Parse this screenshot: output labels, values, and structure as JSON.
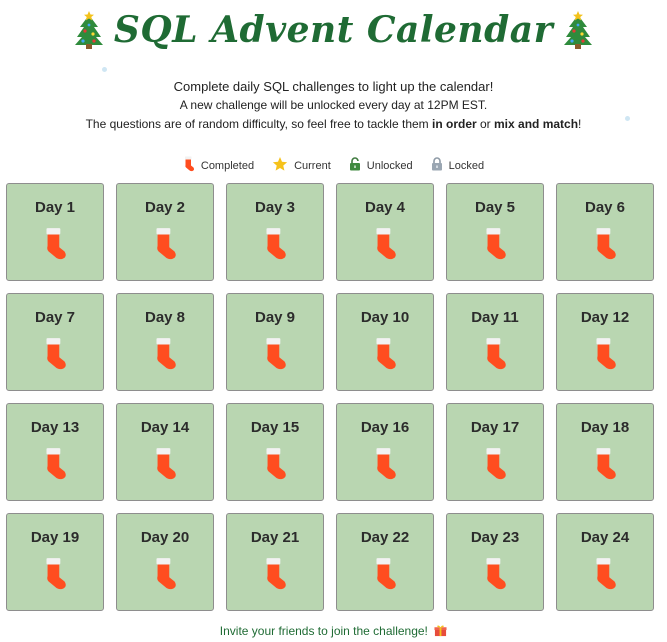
{
  "header": {
    "title": "SQL Advent Calendar",
    "left_icon": "christmas-tree-icon",
    "right_icon": "christmas-tree-icon"
  },
  "intro": {
    "line1": "Complete daily SQL challenges to light up the calendar!",
    "line2": "A new challenge will be unlocked every day at 12PM EST.",
    "line3_prefix": "The questions are of random difficulty, so feel free to tackle them ",
    "line3_bold1": "in order",
    "line3_mid": " or ",
    "line3_bold2": "mix and match",
    "line3_suffix": "!"
  },
  "legend": [
    {
      "icon": "stocking-icon",
      "label": "Completed"
    },
    {
      "icon": "star-icon",
      "label": "Current"
    },
    {
      "icon": "unlocked-padlock-icon",
      "label": "Unlocked"
    },
    {
      "icon": "locked-padlock-icon",
      "label": "Locked"
    }
  ],
  "days": [
    {
      "label": "Day 1",
      "status": "completed"
    },
    {
      "label": "Day 2",
      "status": "completed"
    },
    {
      "label": "Day 3",
      "status": "completed"
    },
    {
      "label": "Day 4",
      "status": "completed"
    },
    {
      "label": "Day 5",
      "status": "completed"
    },
    {
      "label": "Day 6",
      "status": "completed"
    },
    {
      "label": "Day 7",
      "status": "completed"
    },
    {
      "label": "Day 8",
      "status": "completed"
    },
    {
      "label": "Day 9",
      "status": "completed"
    },
    {
      "label": "Day 10",
      "status": "completed"
    },
    {
      "label": "Day 11",
      "status": "completed"
    },
    {
      "label": "Day 12",
      "status": "completed"
    },
    {
      "label": "Day 13",
      "status": "completed"
    },
    {
      "label": "Day 14",
      "status": "completed"
    },
    {
      "label": "Day 15",
      "status": "completed"
    },
    {
      "label": "Day 16",
      "status": "completed"
    },
    {
      "label": "Day 17",
      "status": "completed"
    },
    {
      "label": "Day 18",
      "status": "completed"
    },
    {
      "label": "Day 19",
      "status": "completed"
    },
    {
      "label": "Day 20",
      "status": "completed"
    },
    {
      "label": "Day 21",
      "status": "completed"
    },
    {
      "label": "Day 22",
      "status": "completed"
    },
    {
      "label": "Day 23",
      "status": "completed"
    },
    {
      "label": "Day 24",
      "status": "completed"
    }
  ],
  "footer": {
    "text": "Invite your friends to join the challenge!",
    "icon": "gift-icon"
  },
  "colors": {
    "title": "#1f6b34",
    "tile_background": "#b9d6b1",
    "tile_border": "#8e8e8e",
    "stocking_red": "#ff4d1f",
    "stocking_cuff": "#f2f2f2"
  }
}
